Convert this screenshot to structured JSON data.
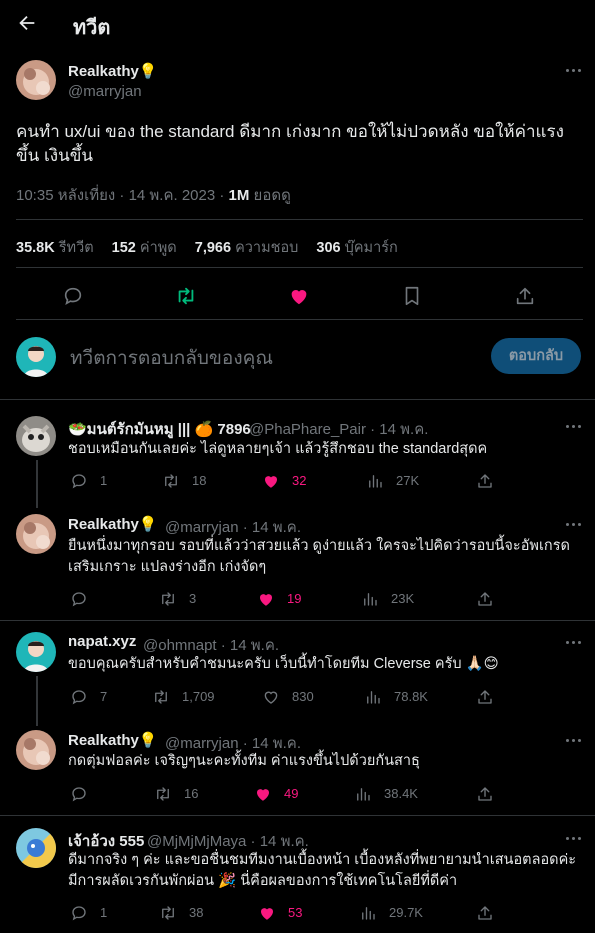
{
  "header": {
    "title": "ทวีต"
  },
  "tweet": {
    "author_name": "Realkathy",
    "author_badge": "💡",
    "author_handle": "@marryjan",
    "text": "คนทำ ux/ui ของ the standard ดีมาก เก่งมาก ขอให้ไม่ปวดหลัง ขอให้ค่าแรงขึ้น เงินขึ้น",
    "timestamp": "10:35 หลังเที่ยง · 14 พ.ค. 2023 · ",
    "views_count": "1M",
    "views_label": " ยอดดู",
    "stats": {
      "retweets_count": "35.8K",
      "retweets_label": " รีทวีต",
      "quotes_count": "152",
      "quotes_label": " ค่าพูด",
      "likes_count": "7,966",
      "likes_label": " ความชอบ",
      "bookmarks_count": "306",
      "bookmarks_label": " บุ๊คมาร์ก"
    }
  },
  "reply_box": {
    "placeholder": "ทวีตการตอบกลับของคุณ",
    "button_label": "ตอบกลับ"
  },
  "replies": [
    {
      "name": "🥗มนต์รักมันหมู ||| 🍊 7896",
      "handle": "@PhaPhare_Pair · 14 พ.ค.",
      "text": "ชอบเหมือนกันเลยค่ะ ไล่ดูหลายๆเจ้า แล้วรู้สึกชอบ the standardสุดค",
      "replies": "1",
      "retweets": "18",
      "likes": "32",
      "views": "27K",
      "liked": true
    },
    {
      "name": "Realkathy💡",
      "handle": "@marryjan · 14 พ.ค.",
      "text": "ยืนหนึ่งมาทุกรอบ รอบที่แล้วว่าสวยแล้ว ดูง่ายแล้ว ใครจะไปคิดว่ารอบนี้จะอัพเกรดเสริมเกราะ แปลงร่างอีก เก่งจัดๆ",
      "replies": "",
      "retweets": "3",
      "likes": "19",
      "views": "23K",
      "liked": true
    },
    {
      "name": "napat.xyz",
      "handle": "@ohmnapt · 14 พ.ค.",
      "text": "ขอบคุณครับสำหรับคำชมนะครับ เว็บนี้ทำโดยทีม Cleverse ครับ 🙏🏻😊",
      "replies": "7",
      "retweets": "1,709",
      "likes": "830",
      "views": "78.8K",
      "liked": false
    },
    {
      "name": "Realkathy💡",
      "handle": "@marryjan · 14 พ.ค.",
      "text": "กดตุ่มฟอลค่ะ เจริญๆนะคะทั้งทีม ค่าแรงขึ้นไปด้วยกันสาธุ",
      "replies": "",
      "retweets": "16",
      "likes": "49",
      "views": "38.4K",
      "liked": true
    },
    {
      "name": "เจ้าอ้วง 555",
      "handle": "@MjMjMjMaya · 14 พ.ค.",
      "text": "ดีมากจริง ๆ ค่ะ และขอชื่นชมทีมงานเบื้องหน้า เบื้องหลังที่พยายามนำเสนอตลอดค่ะ มีการผลัดเวรกันพักผ่อน 🎉 นี่คือผลของการใช้เทคโนโลยีที่ดีค่า",
      "replies": "1",
      "retweets": "38",
      "likes": "53",
      "views": "29.7K",
      "liked": true
    }
  ]
}
